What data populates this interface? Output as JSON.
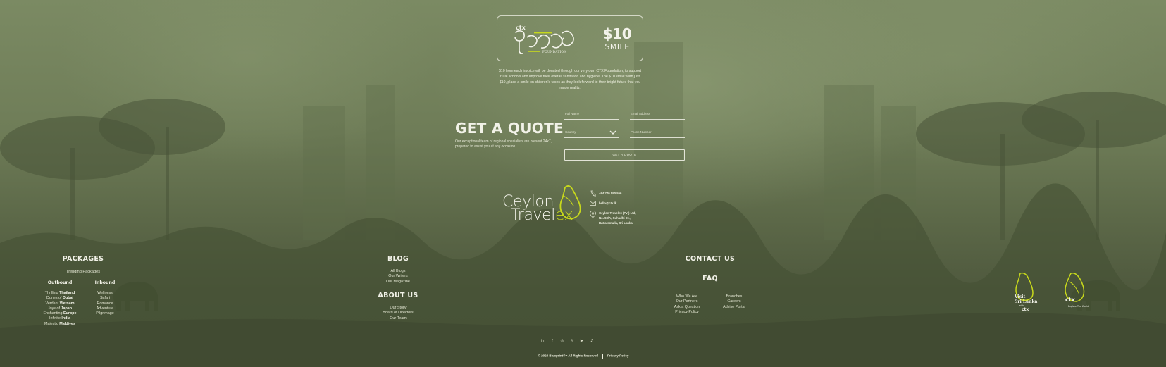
{
  "foundation": {
    "logo_text": "ctx",
    "logo_sub": "FOUNDATION",
    "amount": "$10",
    "smile": "SMILE",
    "description": "$10 from each invoice will be donated through our very own CTX Foundation, to support rural schools and improve their overall sanitation and hygiene. The $10 smile: with just $10, place a smile on children's faces as they look forward to their bright future that you made reality."
  },
  "quote": {
    "title": "GET A QUOTE",
    "subtitle": "Our exceptional team of regional specialists are present 24x7, prepared to assist you at any occasion.",
    "fields": {
      "full_name": "Full Name",
      "email": "Email Address",
      "country": "Country",
      "phone": "Phone Number"
    },
    "button": "GET A QUOTE"
  },
  "brand": {
    "line1": "Ceylon",
    "line2_a": "Travel",
    "line2_b": "ex"
  },
  "contact": {
    "phone": "+94 770 550 556",
    "email": "hello@ctx.lk",
    "address_1": "Ceylon Travelex (Pvt) Ltd,",
    "address_2": "No. 93/A, Suhadhi Dr.,",
    "address_3": "Battaramulla, Sri Lanka."
  },
  "packages": {
    "title": "PACKAGES",
    "trending": "Trending Packages",
    "outbound_title": "Outbound",
    "inbound_title": "Inbound",
    "outbound": [
      {
        "a": "Thrilling ",
        "b": "Thailand"
      },
      {
        "a": "Dunes of ",
        "b": "Dubai"
      },
      {
        "a": "Verdant ",
        "b": "Vietnam"
      },
      {
        "a": "Joys of ",
        "b": "Japan"
      },
      {
        "a": "Enchanting ",
        "b": "Europe"
      },
      {
        "a": "Infinite ",
        "b": "India"
      },
      {
        "a": "Majestic ",
        "b": "Maldives"
      }
    ],
    "inbound": [
      "Wellness",
      "Safari",
      "Romance",
      "Adventure",
      "Pilgrimage"
    ]
  },
  "blog": {
    "title": "BLOG",
    "items": [
      "All Blogs",
      "Our Writers",
      "Our Magazine"
    ]
  },
  "about": {
    "title": "ABOUT US",
    "items": [
      "Our Story",
      "Board of Directors",
      "Our Team"
    ]
  },
  "contact_us": {
    "title": "CONTACT US"
  },
  "faq": {
    "title": "FAQ",
    "left": [
      "Who We Are",
      "Our Partners",
      "Ask a Question",
      "Privacy Policy"
    ],
    "right": [
      "Branches",
      "Careers",
      "Advise Portal"
    ]
  },
  "badges": {
    "visit_1": "Visit",
    "visit_2": "Sri Lanka",
    "visit_3": "with",
    "visit_4": "ctx",
    "ctx_2": "ctx",
    "ctx_tag": "Explore The World"
  },
  "socials": [
    "in",
    "f",
    "◎",
    "𝕏",
    "▶",
    "♪"
  ],
  "footer": {
    "copyright": "© 2024 Blueprint® • All Rights Reserved",
    "privacy": "Privacy Policy"
  },
  "colors": {
    "accent": "#c8d91c",
    "bg_top": "#7b8a63",
    "bg_bottom": "#4a5439",
    "text": "#eef0e0"
  }
}
